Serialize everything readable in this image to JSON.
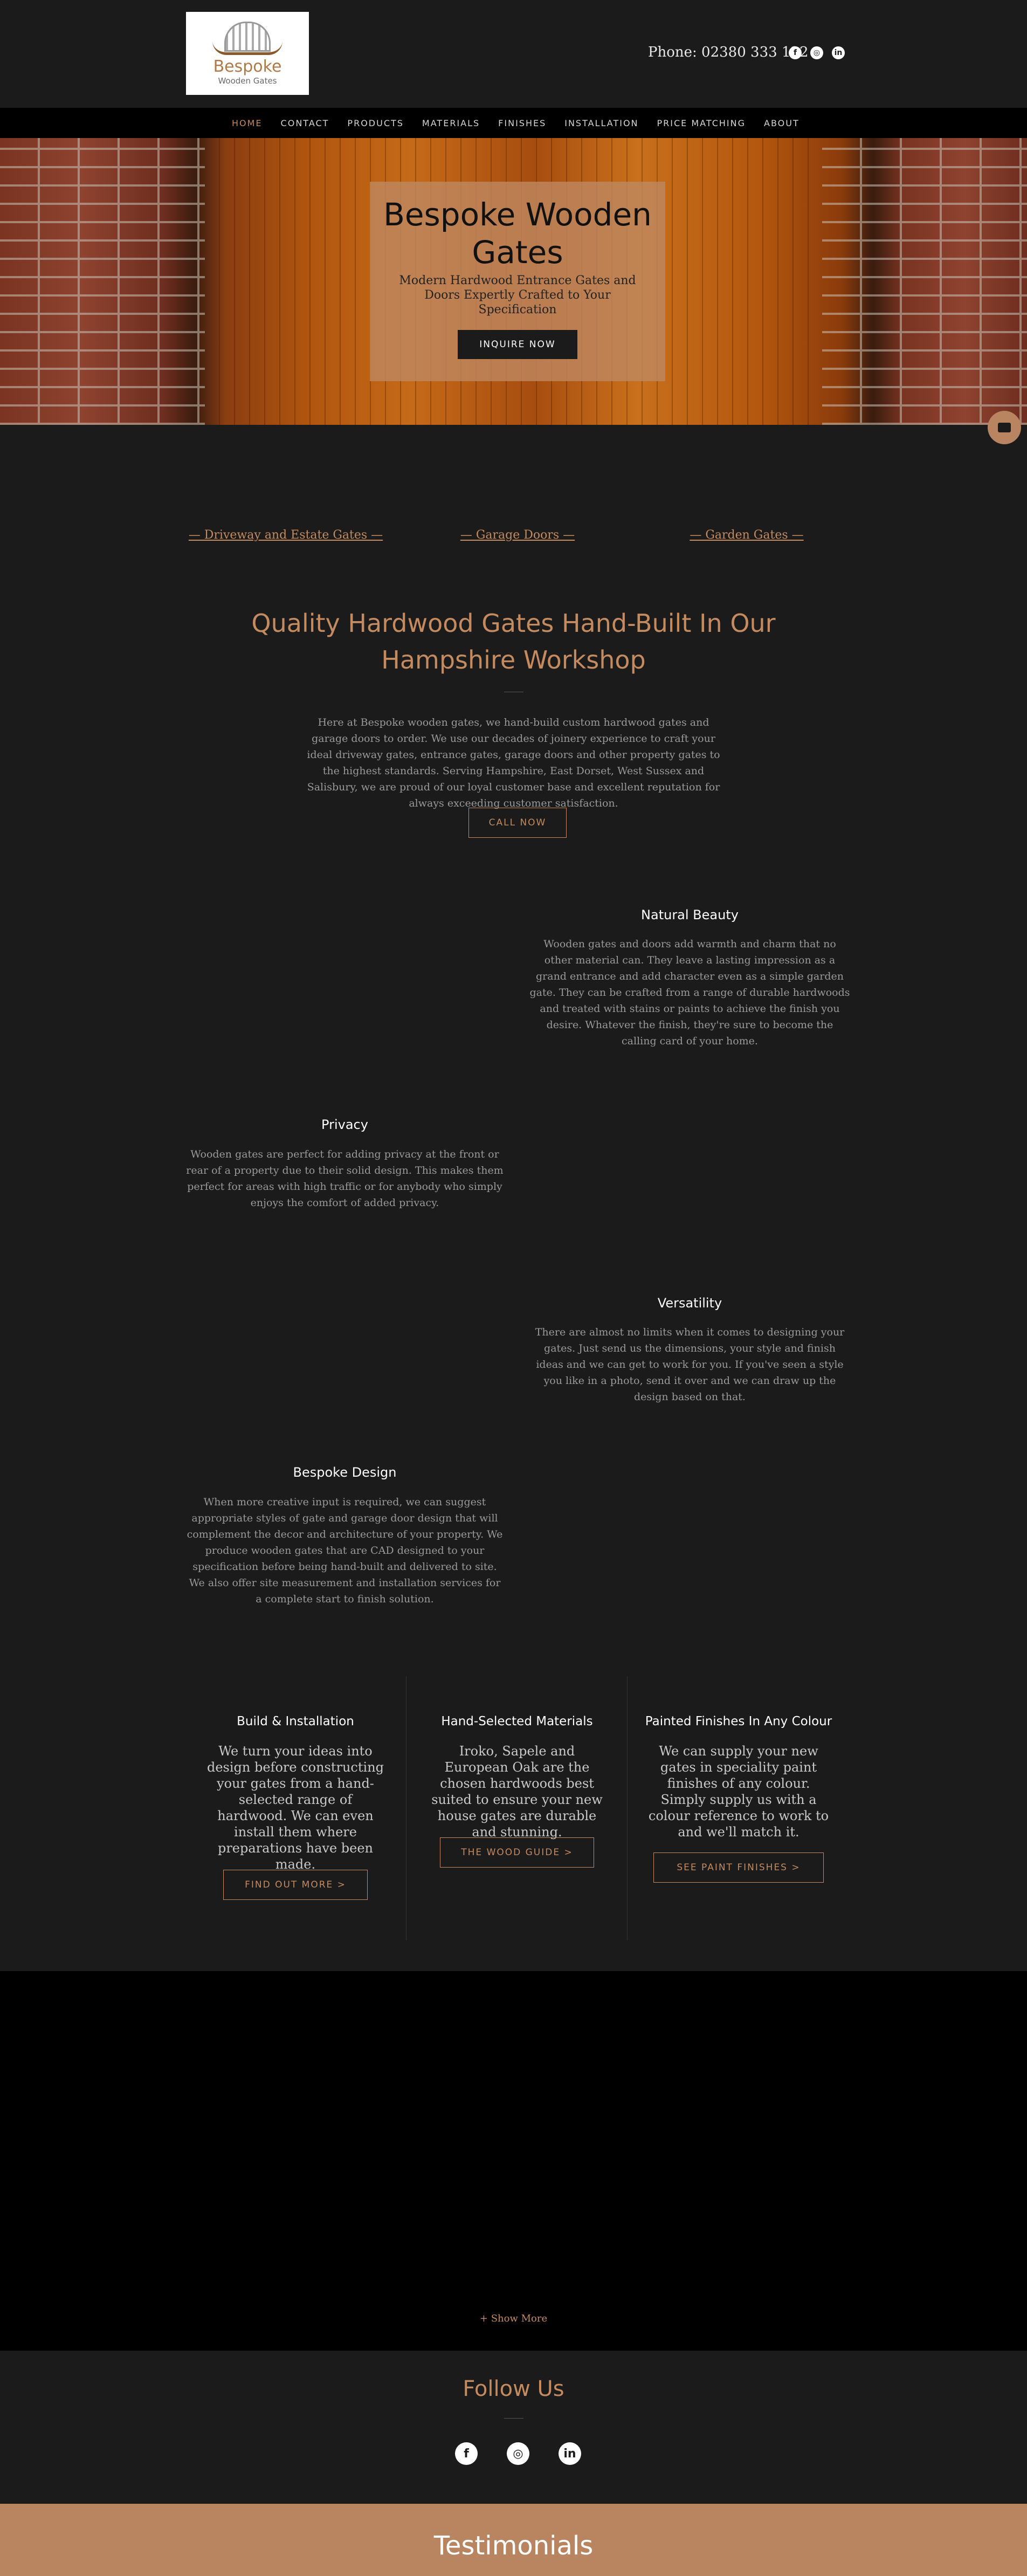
{
  "header": {
    "logo": {
      "name": "Bespoke",
      "tagline": "Wooden Gates"
    },
    "phone": "Phone: 02380 333 122",
    "social": [
      {
        "icon": "facebook-icon",
        "glyph": "f"
      },
      {
        "icon": "instagram-icon",
        "glyph": "◎"
      },
      {
        "icon": "linkedin-icon",
        "glyph": "in"
      }
    ]
  },
  "nav": {
    "items": [
      "HOME",
      "CONTACT",
      "PRODUCTS",
      "MATERIALS",
      "FINISHES",
      "INSTALLATION",
      "PRICE MATCHING",
      "ABOUT"
    ],
    "active": "HOME"
  },
  "hero": {
    "title": "Bespoke Wooden Gates",
    "subtitle": "Modern Hardwood Entrance Gates and Doors Expertly Crafted to Your Specification",
    "button": "INQUIRE NOW"
  },
  "categories": [
    "— Driveway and Estate Gates —",
    "— Garage Doors —",
    "— Garden Gates —"
  ],
  "intro": {
    "title": "Quality Hardwood Gates Hand-Built In Our Hampshire Workshop",
    "text": "Here at Bespoke wooden gates, we hand-build custom hardwood gates and garage doors to order. We use our decades of joinery experience to craft your ideal driveway gates, entrance gates, garage doors and other property gates to the highest standards. Serving Hampshire, East Dorset, West Sussex and Salisbury, we are proud of our loyal customer base and excellent reputation for always exceeding customer satisfaction.",
    "button": "CALL NOW"
  },
  "features": [
    {
      "title": "Natural Beauty",
      "text": "Wooden gates and doors add warmth and charm that no other material can. They leave a lasting impression as a grand entrance and add character even as a simple garden gate. They can be crafted from a range of durable hardwoods and treated with stains or paints to achieve the finish you desire. Whatever the finish, they're sure to become the calling card of your home."
    },
    {
      "title": "Privacy",
      "text": "Wooden gates are perfect for adding privacy at the front or rear of a property due to their solid design. This makes them perfect for areas with high traffic or for anybody who simply enjoys the comfort of added privacy."
    },
    {
      "title": "Versatility",
      "text": "There are almost no limits when it comes to designing your gates. Just send us the dimensions, your style and finish ideas and we can get to work for you. If you've seen a style you like in a photo, send it over and we can draw up the design based on that."
    },
    {
      "title": "Bespoke Design",
      "text": "When more creative input is required, we can suggest appropriate styles of gate and garage door design that will complement the decor and architecture of your property. We produce wooden gates that are CAD designed to your specification before being hand-built and delivered to site. We also offer site measurement and installation services for a complete start to finish solution."
    }
  ],
  "columns": [
    {
      "title": "Build & Installation",
      "text": "We turn your ideas into design before constructing your gates from a hand-selected range of hardwood. We can even install them where preparations have been made.",
      "button": "FIND OUT MORE >"
    },
    {
      "title": "Hand-Selected Materials",
      "text": "Iroko, Sapele and European Oak are the chosen hardwoods best suited to ensure your new house gates are durable and stunning.",
      "button": "THE WOOD GUIDE >"
    },
    {
      "title": "Painted Finishes In Any Colour",
      "text": "We can supply your new gates in speciality paint finishes of any colour. Simply supply us with a colour reference to work to and we'll match it.",
      "button": "SEE PAINT FINISHES >"
    }
  ],
  "gallery": {
    "show_more": "+ Show More"
  },
  "follow": {
    "title": "Follow Us",
    "icons": [
      {
        "icon": "facebook-icon",
        "glyph": "f"
      },
      {
        "icon": "instagram-icon",
        "glyph": "◎"
      },
      {
        "icon": "linkedin-icon",
        "glyph": "in"
      }
    ]
  },
  "testimonials": {
    "title": "Testimonials"
  },
  "colors": {
    "accent": "#c38b5f",
    "background": "#1b1b1b",
    "testimonials_bg": "#b98561"
  }
}
